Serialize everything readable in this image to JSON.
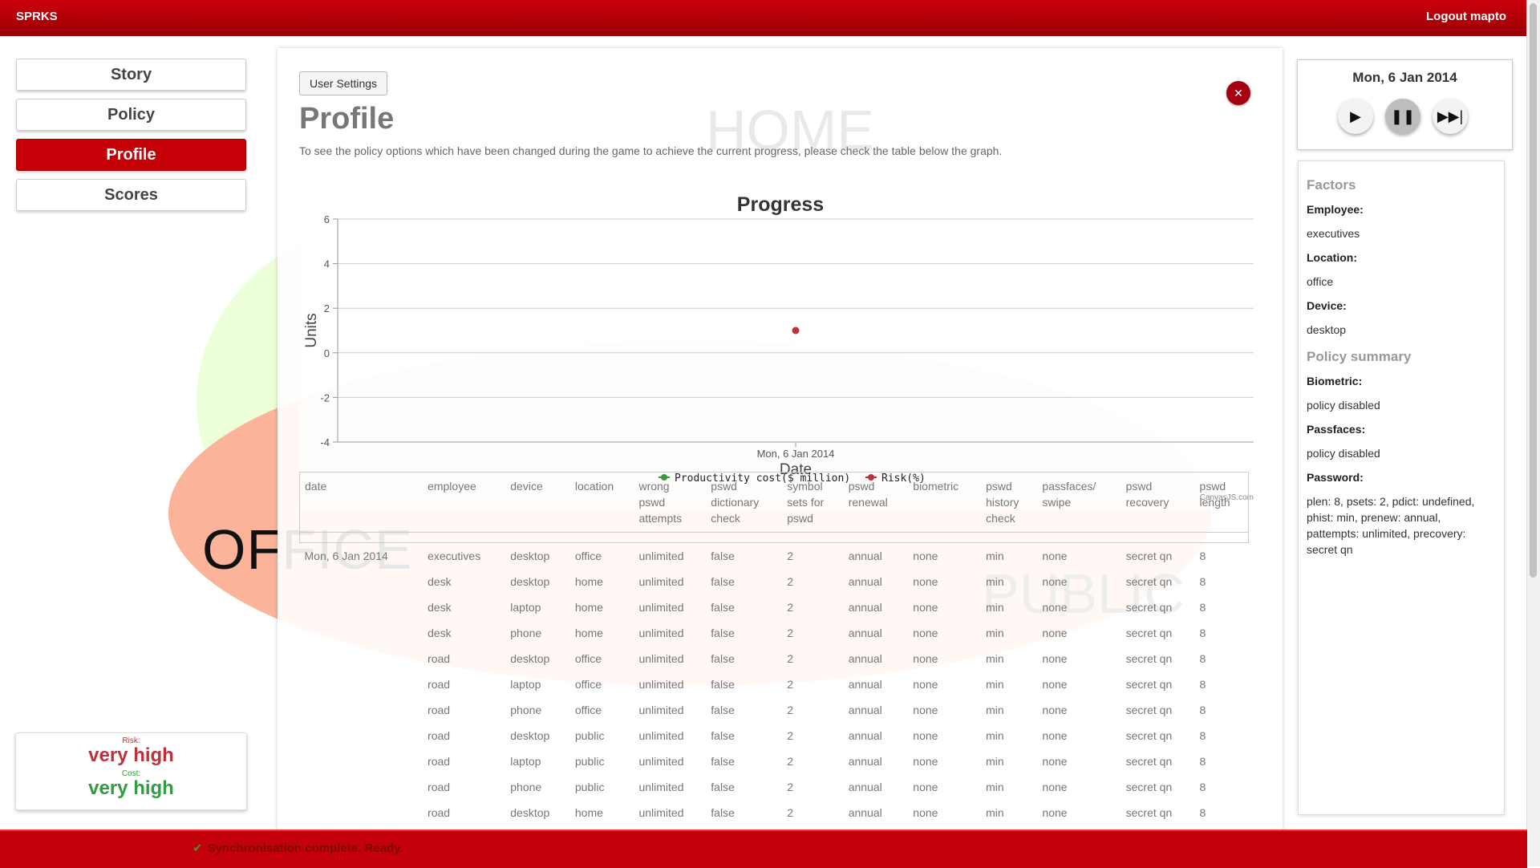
{
  "app": {
    "brand": "SPRKS",
    "logout": "Logout mapto"
  },
  "nav": {
    "items": [
      "Story",
      "Policy",
      "Profile",
      "Scores"
    ],
    "active": "Profile"
  },
  "background": {
    "office_label": "OFFICE",
    "home_label": "HOME",
    "public_label": "PUBLIC"
  },
  "indicator": {
    "risk_label": "Risk:",
    "risk_value": "very high",
    "cost_label": "Cost:",
    "cost_value": "very high"
  },
  "main": {
    "settings_button": "User Settings",
    "close_icon": "close-icon",
    "title": "Profile",
    "description": "To see the policy options which have been changed during the game to achieve the current progress, please check the table below the graph."
  },
  "chart_data": {
    "type": "scatter",
    "title": "Progress",
    "xlabel": "Date",
    "ylabel": "Units",
    "x_ticks": [
      "Mon, 6 Jan 2014"
    ],
    "y_ticks": [
      6,
      4,
      2,
      0,
      -2,
      -4
    ],
    "ylim": [
      -4,
      6
    ],
    "grid": true,
    "legend_position": "bottom",
    "series": [
      {
        "name": "Productivity cost($ million)",
        "color": "#3a9a3a",
        "points": []
      },
      {
        "name": "Risk(%)",
        "color": "#c0303a",
        "points": [
          {
            "x": "Mon, 6 Jan 2014",
            "y": 1
          }
        ]
      }
    ],
    "credit": "CanvasJS.com"
  },
  "table": {
    "headers": [
      [
        "date"
      ],
      [
        "employee"
      ],
      [
        "device"
      ],
      [
        "location"
      ],
      [
        "wrong",
        "pswd",
        "attempts"
      ],
      [
        "pswd",
        "dictionary",
        "check"
      ],
      [
        "symbol",
        "sets for",
        "pswd"
      ],
      [
        "pswd",
        "renewal"
      ],
      [
        "biometric"
      ],
      [
        "pswd",
        "history",
        "check"
      ],
      [
        "passfaces/",
        "swipe"
      ],
      [
        "pswd",
        "recovery"
      ],
      [
        "pswd",
        "length"
      ]
    ],
    "rows": [
      [
        "Mon, 6 Jan 2014",
        "executives",
        "desktop",
        "office",
        "unlimited",
        "false",
        "2",
        "annual",
        "none",
        "min",
        "none",
        "secret qn",
        "8"
      ],
      [
        "",
        "desk",
        "desktop",
        "home",
        "unlimited",
        "false",
        "2",
        "annual",
        "none",
        "min",
        "none",
        "secret qn",
        "8"
      ],
      [
        "",
        "desk",
        "laptop",
        "home",
        "unlimited",
        "false",
        "2",
        "annual",
        "none",
        "min",
        "none",
        "secret qn",
        "8"
      ],
      [
        "",
        "desk",
        "phone",
        "home",
        "unlimited",
        "false",
        "2",
        "annual",
        "none",
        "min",
        "none",
        "secret qn",
        "8"
      ],
      [
        "",
        "road",
        "desktop",
        "office",
        "unlimited",
        "false",
        "2",
        "annual",
        "none",
        "min",
        "none",
        "secret qn",
        "8"
      ],
      [
        "",
        "road",
        "laptop",
        "office",
        "unlimited",
        "false",
        "2",
        "annual",
        "none",
        "min",
        "none",
        "secret qn",
        "8"
      ],
      [
        "",
        "road",
        "phone",
        "office",
        "unlimited",
        "false",
        "2",
        "annual",
        "none",
        "min",
        "none",
        "secret qn",
        "8"
      ],
      [
        "",
        "road",
        "desktop",
        "public",
        "unlimited",
        "false",
        "2",
        "annual",
        "none",
        "min",
        "none",
        "secret qn",
        "8"
      ],
      [
        "",
        "road",
        "laptop",
        "public",
        "unlimited",
        "false",
        "2",
        "annual",
        "none",
        "min",
        "none",
        "secret qn",
        "8"
      ],
      [
        "",
        "road",
        "phone",
        "public",
        "unlimited",
        "false",
        "2",
        "annual",
        "none",
        "min",
        "none",
        "secret qn",
        "8"
      ],
      [
        "",
        "road",
        "desktop",
        "home",
        "unlimited",
        "false",
        "2",
        "annual",
        "none",
        "min",
        "none",
        "secret qn",
        "8"
      ]
    ]
  },
  "right": {
    "date": "Mon, 6 Jan 2014",
    "controls": [
      "play-icon",
      "pause-icon",
      "fast-forward-icon"
    ],
    "factors_title": "Factors",
    "employee_label": "Employee:",
    "employee_value": "executives",
    "location_label": "Location:",
    "location_value": "office",
    "device_label": "Device:",
    "device_value": "desktop",
    "policy_title": "Policy summary",
    "biometric_label": "Biometric:",
    "biometric_value": "policy disabled",
    "passfaces_label": "Passfaces:",
    "passfaces_value": "policy disabled",
    "password_label": "Password:",
    "password_value": "plen: 8, psets: 2, pdict: undefined, phist: min, prenew: annual, pattempts: unlimited, precovery: secret qn"
  },
  "status": {
    "icon": "check-icon",
    "text": "Synchronisation complete. Ready."
  },
  "colors": {
    "brand_red": "#c4000a",
    "active_nav": "#c40006",
    "risk": "#c0303a",
    "cost": "#2e9e3e"
  }
}
